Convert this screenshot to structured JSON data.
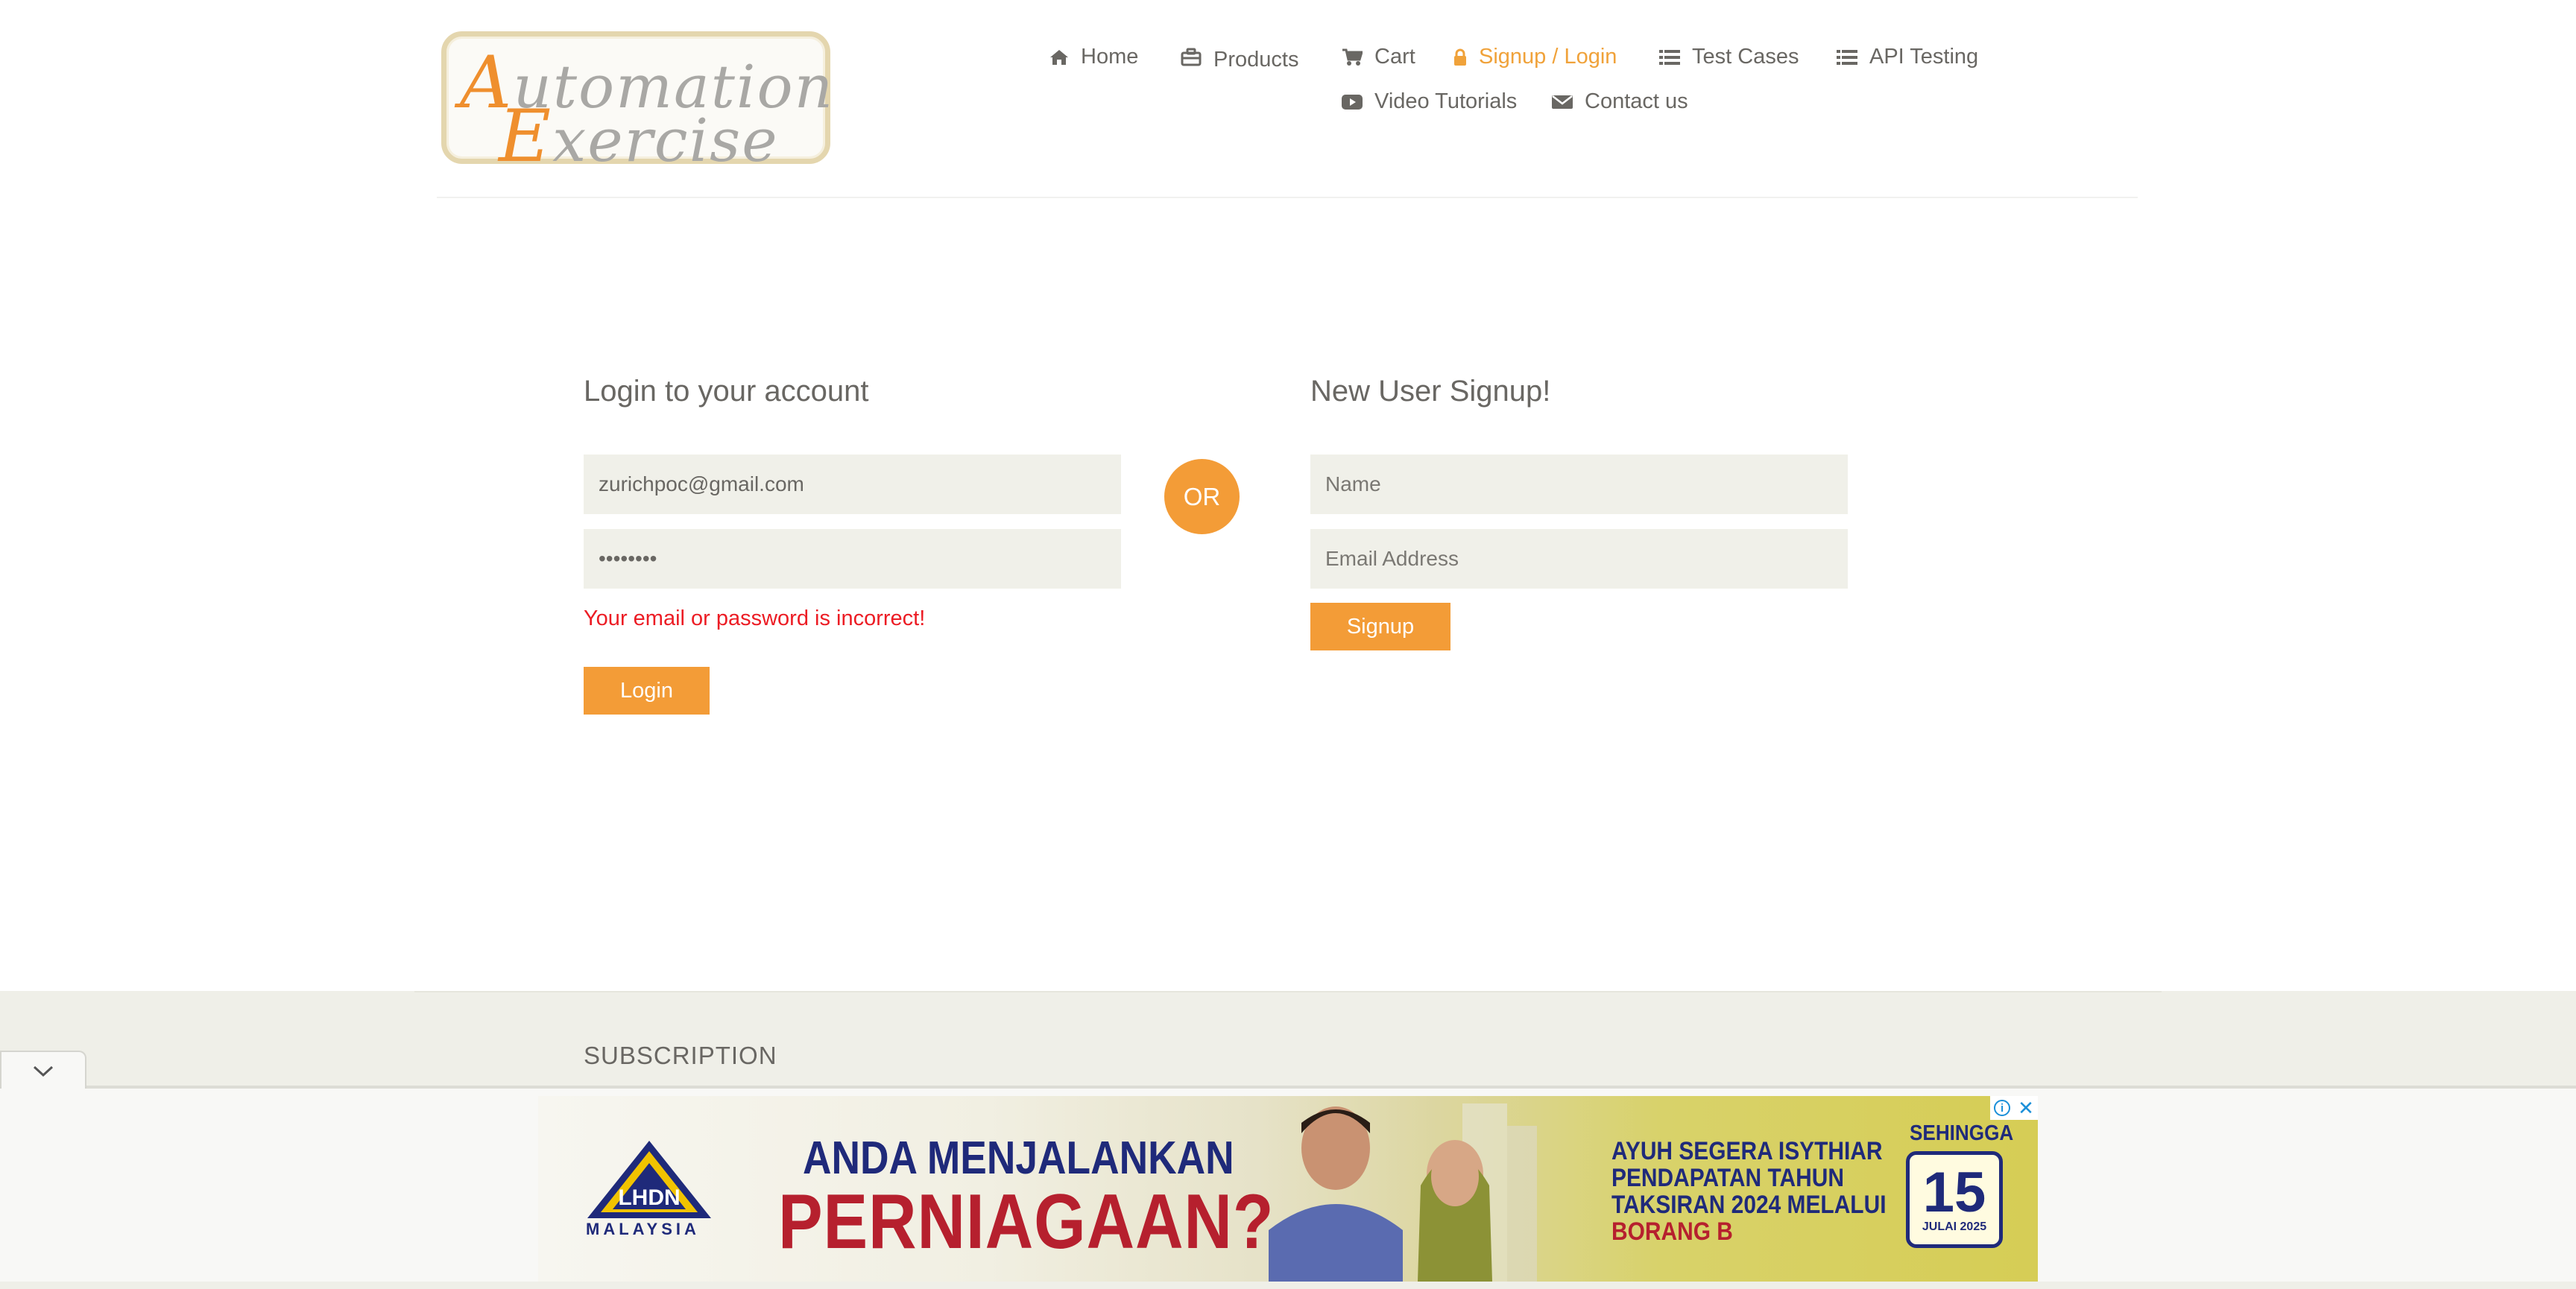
{
  "brand": {
    "logo_line1": "Automation",
    "logo_line2": "Exercise"
  },
  "nav": [
    {
      "label": "Home",
      "icon": "home-icon"
    },
    {
      "label": "Products",
      "icon": "briefcase-icon"
    },
    {
      "label": "Cart",
      "icon": "cart-icon"
    },
    {
      "label": "Signup / Login",
      "icon": "lock-icon",
      "active": true
    },
    {
      "label": "Test Cases",
      "icon": "list-icon"
    },
    {
      "label": "API Testing",
      "icon": "list-icon"
    },
    {
      "label": "Video Tutorials",
      "icon": "youtube-icon"
    },
    {
      "label": "Contact us",
      "icon": "envelope-icon"
    }
  ],
  "login": {
    "title": "Login to your account",
    "email_value": "zurichpoc@gmail.com",
    "password_value": "••••••••",
    "error": "Your email or password is incorrect!",
    "button": "Login"
  },
  "divider": {
    "label": "OR"
  },
  "signup": {
    "title": "New User Signup!",
    "name_placeholder": "Name",
    "email_placeholder": "Email Address",
    "button": "Signup"
  },
  "footer": {
    "subscription_title": "SUBSCRIPTION"
  },
  "ad": {
    "logo_text": "MALAYSIA",
    "logo_abbr": "LHDN",
    "headline1": "ANDA MENJALANKAN",
    "headline2": "PERNIAGAAN?",
    "right_line1": "AYUH SEGERA ISYTHIAR",
    "right_line2": "PENDAPATAN TAHUN",
    "right_line3": "TAKSIRAN 2024 MELALUI",
    "right_line4": "BORANG B",
    "until": "SEHINGGA",
    "date_day": "15",
    "date_month": "JULAI 2025"
  },
  "colors": {
    "accent": "#FE980F",
    "error": "#EC1C24",
    "text": "#696763",
    "field_bg": "#F0F0E9"
  }
}
